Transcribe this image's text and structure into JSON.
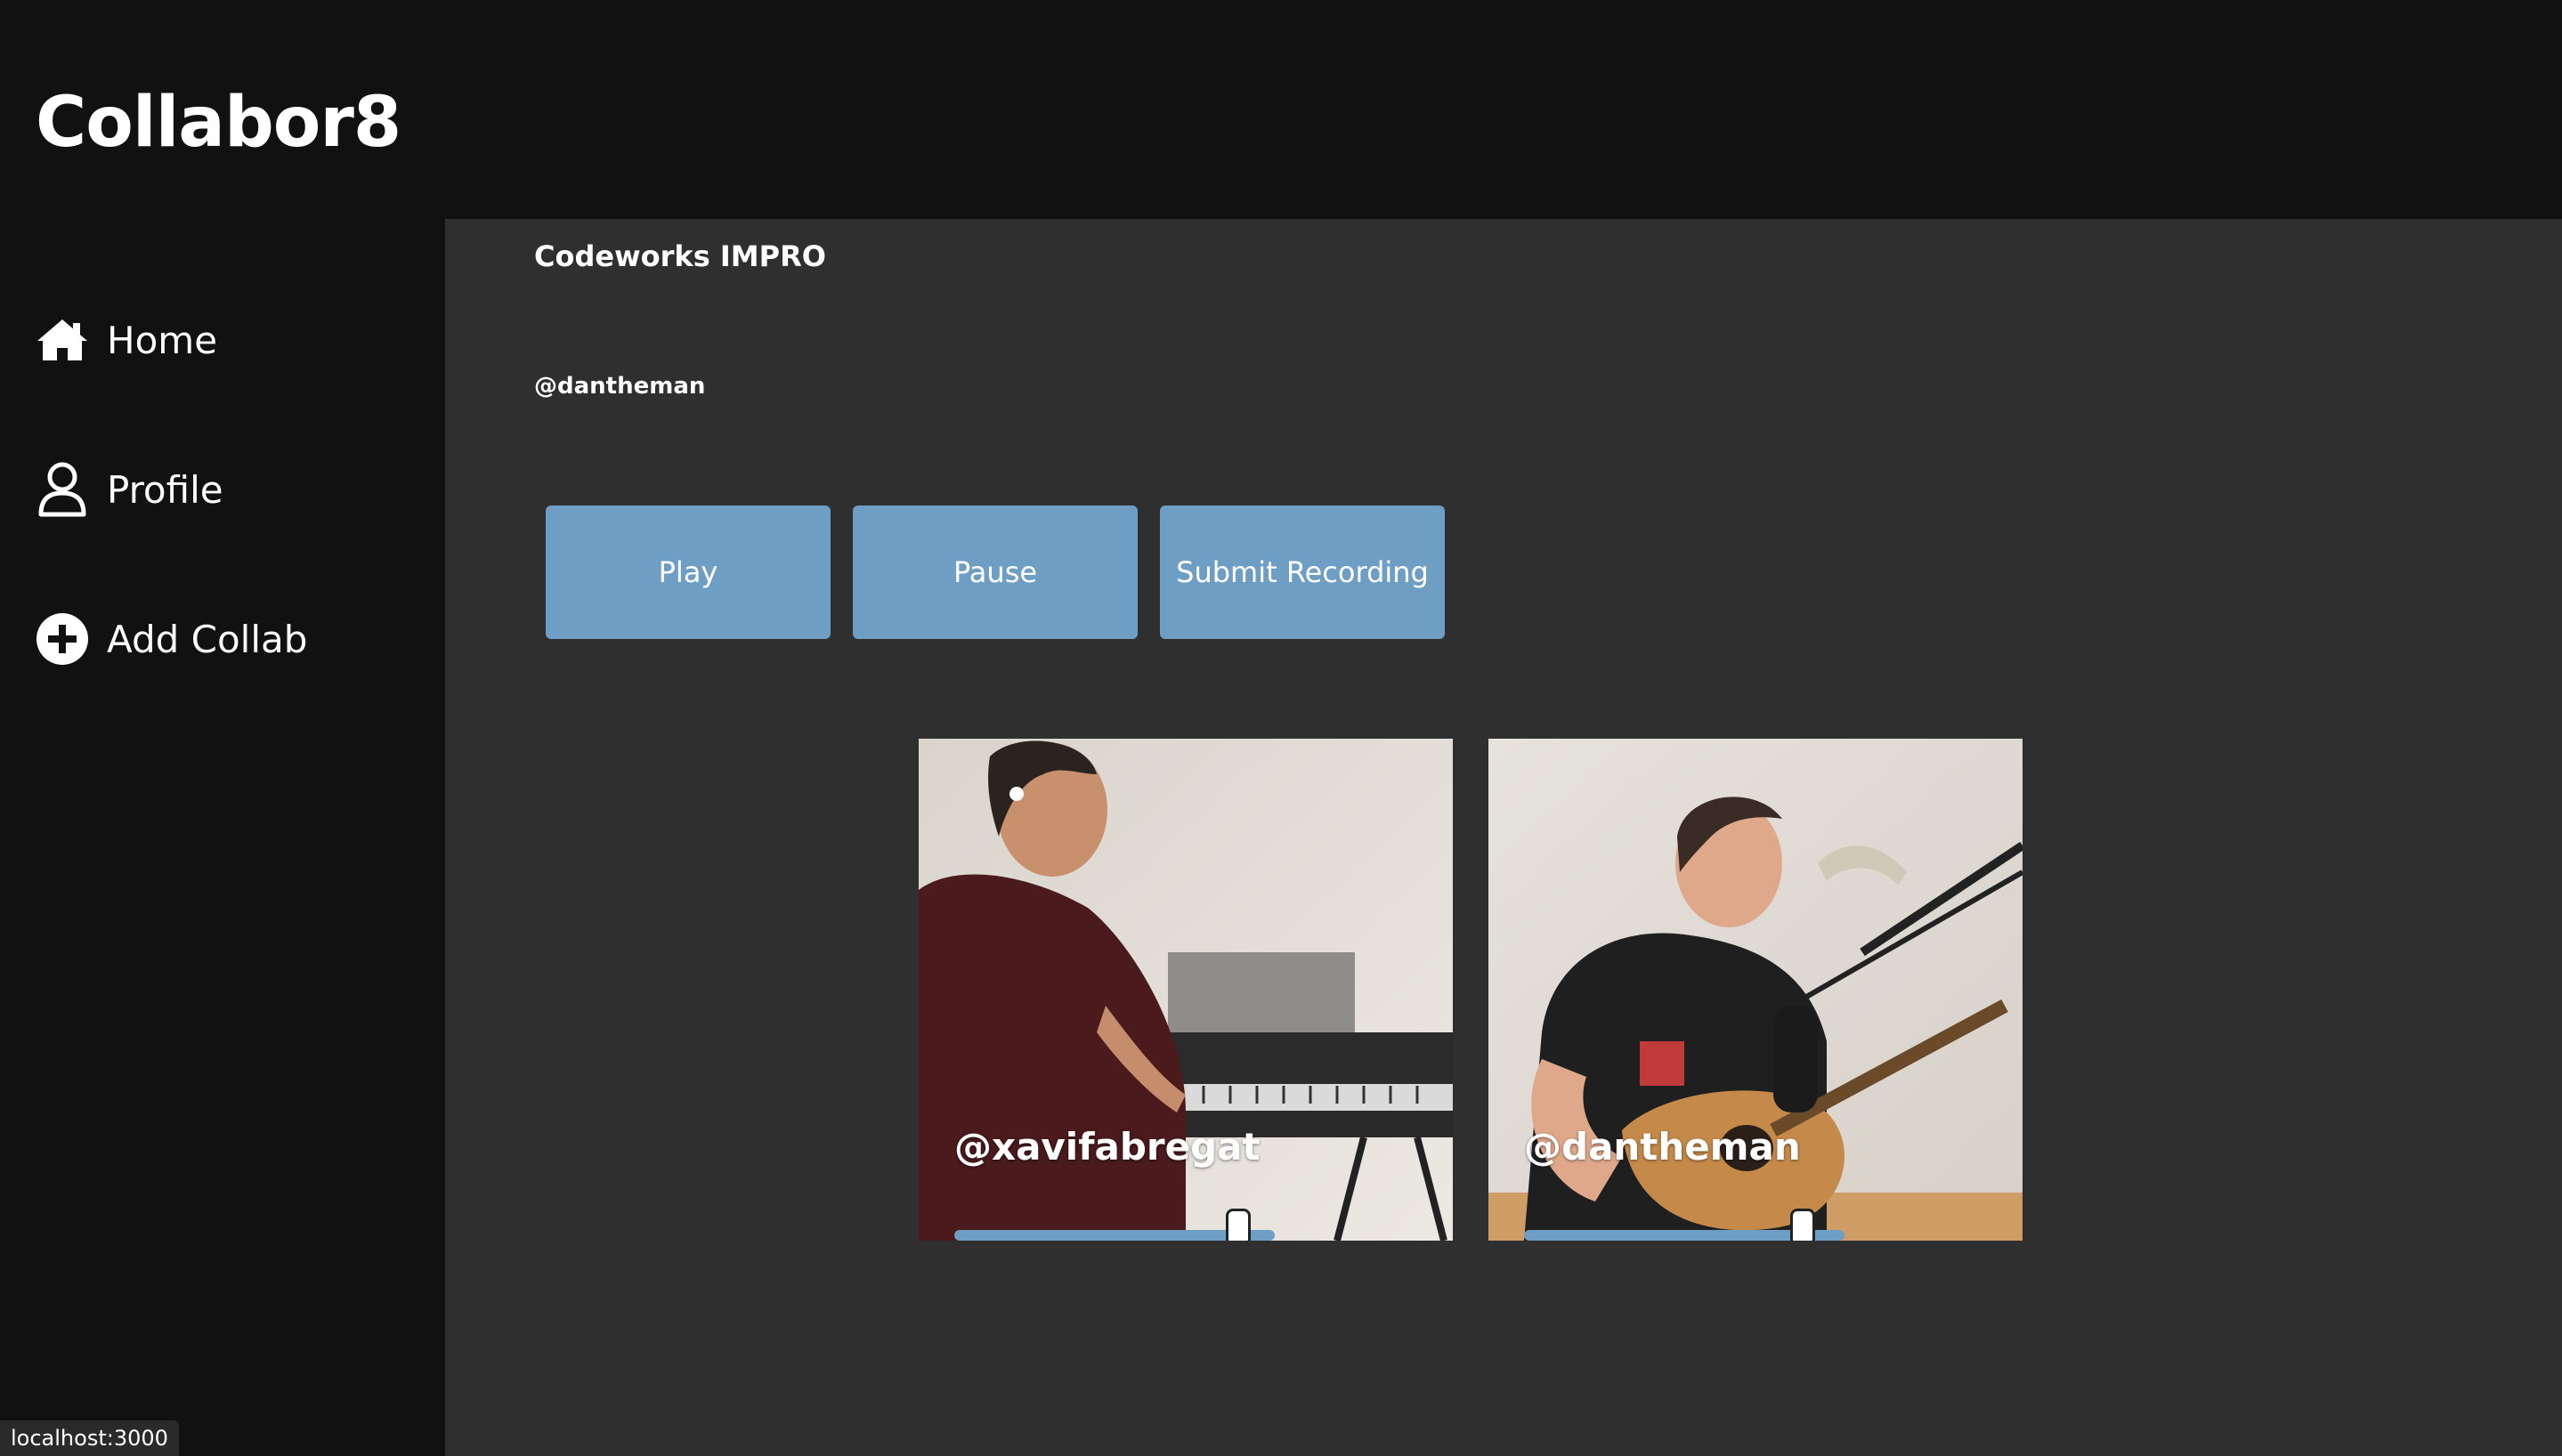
{
  "app": {
    "title": "Collabor8"
  },
  "sidebar": {
    "items": [
      {
        "label": "Home",
        "icon": "home-icon"
      },
      {
        "label": "Profile",
        "icon": "user-icon"
      },
      {
        "label": "Add Collab",
        "icon": "plus-circle-icon"
      }
    ]
  },
  "collab": {
    "title": "Codeworks IMPRO",
    "owner": "@dantheman"
  },
  "controls": {
    "play_label": "Play",
    "pause_label": "Pause",
    "submit_label": "Submit Recording"
  },
  "tracks": [
    {
      "user": "@xavifabregat",
      "volume": 0.92,
      "scene": "pianist"
    },
    {
      "user": "@dantheman",
      "volume": 0.9,
      "scene": "guitarist"
    }
  ],
  "status_bar": {
    "url": "localhost:3000"
  },
  "colors": {
    "background": "#111111",
    "panel": "#2f2f2f",
    "button": "#6e9ec4",
    "text": "#ffffff"
  }
}
